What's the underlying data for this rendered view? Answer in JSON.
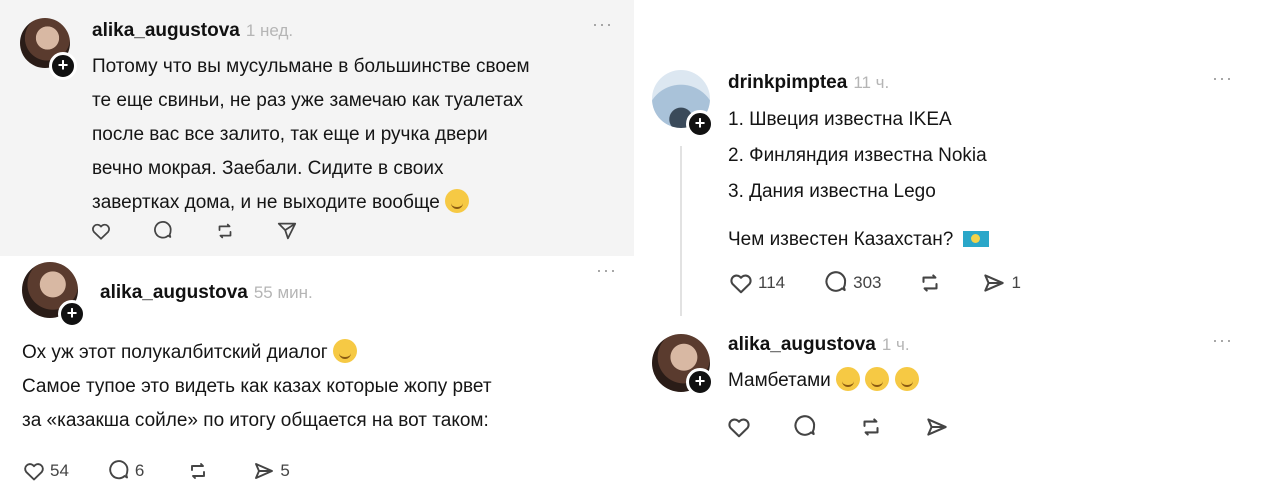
{
  "post1": {
    "username": "alika_augustova",
    "time": "1 нед.",
    "more": "···",
    "lines": [
      "Потому что вы мусульмане в большинстве своем",
      "те еще свиньи, не раз уже замечаю как туалетах",
      "после вас все залито, так еще и ручка двери",
      "вечно мокрая. Заебали. Сидите в своих",
      "завертках дома, и не выходите вообще"
    ],
    "emoji": "smirk-face"
  },
  "post2": {
    "username": "alika_augustova",
    "time": "55 мин.",
    "more": "···",
    "lines": [
      "Ох уж этот полукалбитский диалог",
      "Самое тупое это видеть как казах которые жопу рвет",
      "за «казакша сойле» по итогу общается на вот таком:"
    ],
    "emoji": "laughing-face",
    "likes": "54",
    "comments": "6",
    "shares": "5"
  },
  "post3": {
    "username": "drinkpimptea",
    "time": "11 ч.",
    "more": "···",
    "lines": [
      "1. Швеция известна IKEA",
      "2. Финляндия известна Nokia",
      "3. Дания известна Lego"
    ],
    "question": "Чем известен Казахстан?",
    "flag": "kazakhstan-flag",
    "likes": "114",
    "comments": "303",
    "shares": "1"
  },
  "post4": {
    "username": "alika_augustova",
    "time": "1 ч.",
    "more": "···",
    "text": "Мамбетами",
    "emoji": "smirk-face"
  },
  "icons": [
    "heart-icon",
    "comment-icon",
    "repost-icon",
    "share-icon"
  ],
  "colors": {
    "text": "#111111",
    "muted": "#b5b5b5",
    "card_gray": "#f4f4f4",
    "flag": "#2aa7c9"
  }
}
